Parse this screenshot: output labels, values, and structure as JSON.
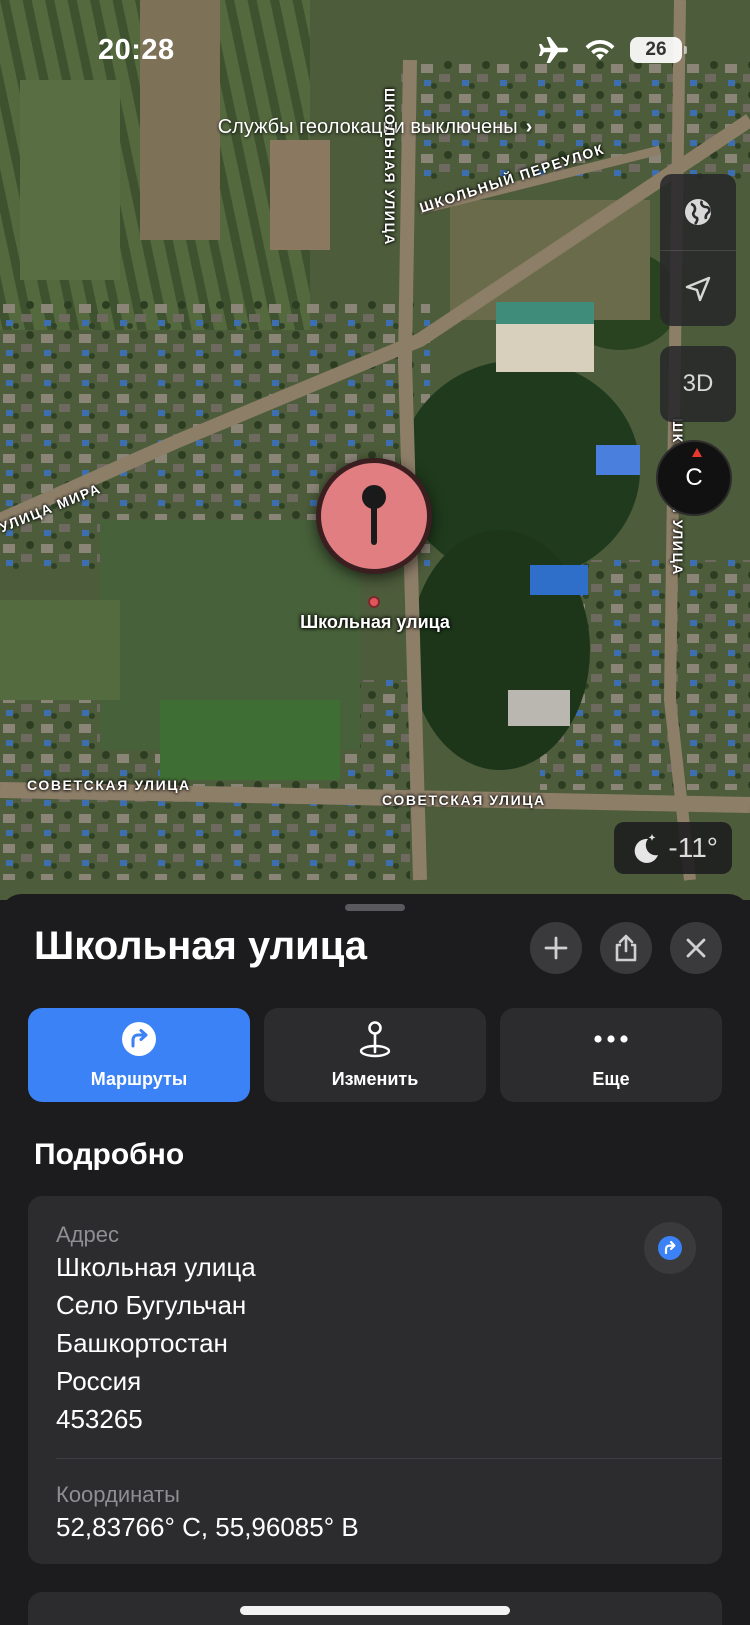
{
  "status_bar": {
    "time": "20:28",
    "battery": "26",
    "icons": [
      "airplane-icon",
      "wifi-icon",
      "battery-icon"
    ]
  },
  "map": {
    "location_banner": "Службы геолокации выключены",
    "streets": [
      "ШКОЛЬНЫЙ ПЕРЕУЛОК",
      "ШКОЛЬНАЯ УЛИЦА",
      "УЛИЦА МИРА",
      "СОВЕТСКАЯ УЛИЦА",
      "СОВЕТСКАЯ УЛИЦА",
      "ШКОЛЬНАЯ УЛИЦА"
    ],
    "controls": {
      "globe": "globe-icon",
      "locate": "location-arrow-icon",
      "three_d": "3D",
      "compass": "С"
    },
    "pin_label": "Школьная улица",
    "weather": "-11°"
  },
  "sheet": {
    "title": "Школьная улица",
    "actions": [
      {
        "label": "Маршруты",
        "icon": "route-arrow-icon"
      },
      {
        "label": "Изменить",
        "icon": "pin-edit-icon"
      },
      {
        "label": "Еще",
        "icon": "more-dots-icon"
      }
    ],
    "details_title": "Подробно",
    "address_label": "Адрес",
    "address_lines": [
      "Школьная улица",
      "Село Бугульчан",
      "Башкортостан",
      "Россия",
      "453265"
    ],
    "coords_label": "Координаты",
    "coords": "52,83766° С, 55,96085° В"
  },
  "colors": {
    "accent": "#3b82f6",
    "pin": "#e07e81",
    "sheet_bg": "#1c1c1e",
    "card_bg": "#2c2c2e"
  }
}
